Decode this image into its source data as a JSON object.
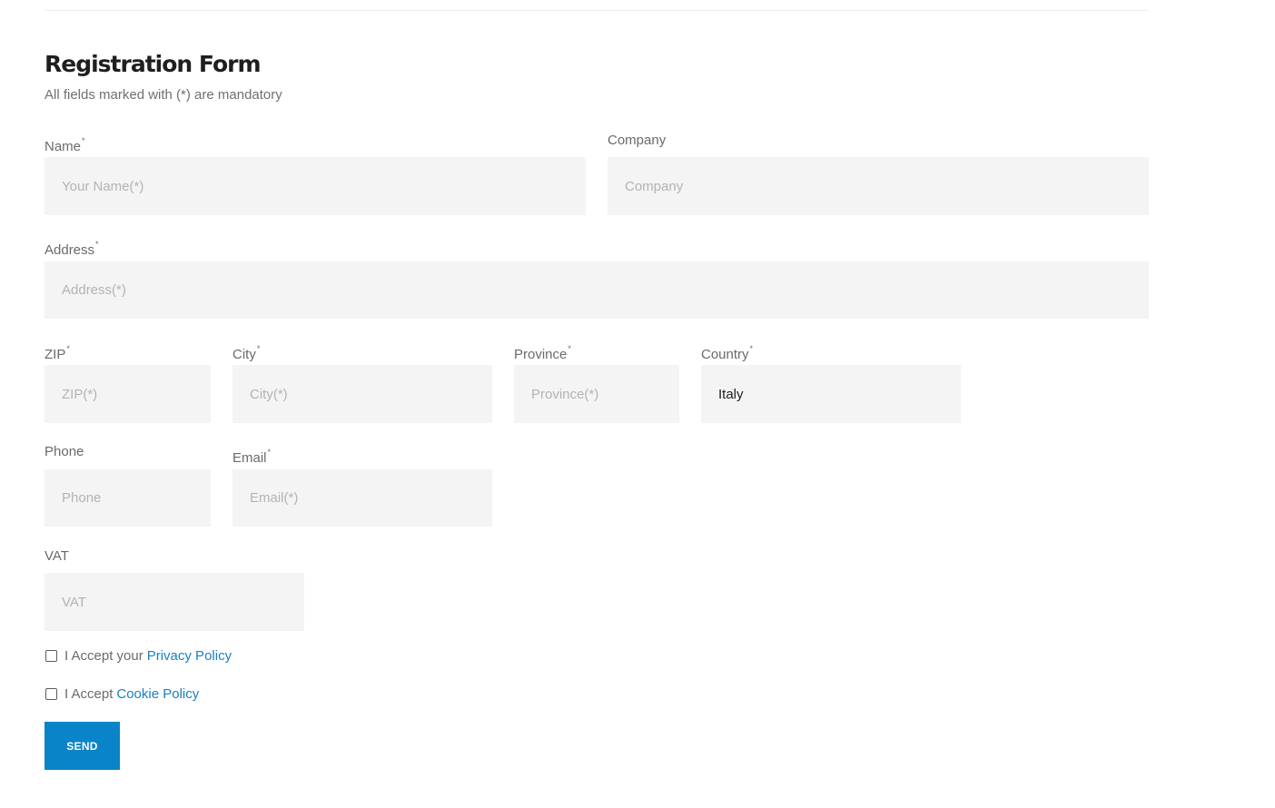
{
  "form": {
    "title": "Registration Form",
    "subtitle": "All fields marked with (*) are mandatory",
    "fields": {
      "name": {
        "label": "Name",
        "required_mark": "*",
        "placeholder": "Your Name(*)",
        "value": ""
      },
      "company": {
        "label": "Company",
        "placeholder": "Company",
        "value": ""
      },
      "address": {
        "label": "Address",
        "required_mark": "*",
        "placeholder": "Address(*)",
        "value": ""
      },
      "zip": {
        "label": "ZIP",
        "required_mark": "*",
        "placeholder": "ZIP(*)",
        "value": ""
      },
      "city": {
        "label": "City",
        "required_mark": "*",
        "placeholder": "City(*)",
        "value": ""
      },
      "province": {
        "label": "Province",
        "required_mark": "*",
        "placeholder": "Province(*)",
        "value": ""
      },
      "country": {
        "label": "Country",
        "required_mark": "*",
        "placeholder": "",
        "value": "Italy"
      },
      "phone": {
        "label": "Phone",
        "placeholder": "Phone",
        "value": ""
      },
      "email": {
        "label": "Email",
        "required_mark": "*",
        "placeholder": "Email(*)",
        "value": ""
      },
      "vat": {
        "label": "VAT",
        "placeholder": "VAT",
        "value": ""
      }
    },
    "privacy": {
      "text": "I Accept your",
      "link": "Privacy Policy"
    },
    "cookie": {
      "text": "I Accept",
      "link": "Cookie Policy"
    },
    "send_label": "SEND"
  }
}
